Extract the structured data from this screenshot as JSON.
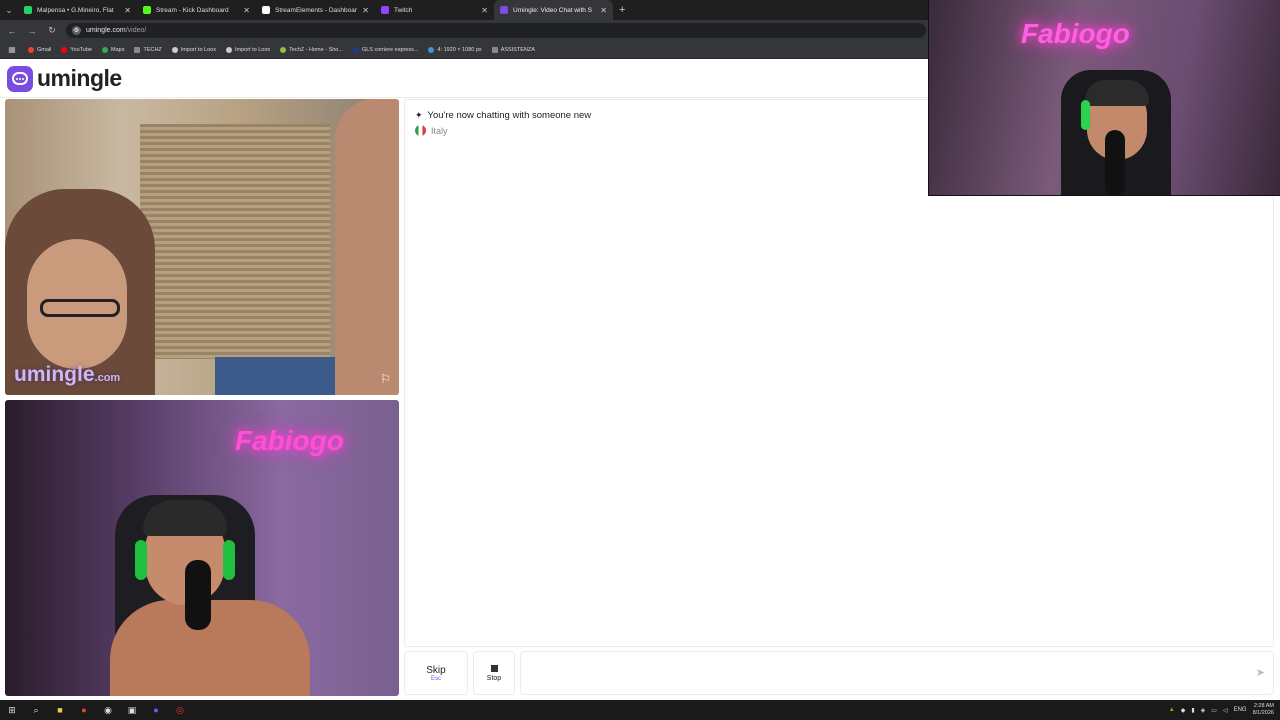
{
  "browser": {
    "tabs": [
      {
        "title": "Malpensa • G.Mineiro, Flat",
        "color": "#25d366"
      },
      {
        "title": "Stream - Kick Dashboard",
        "color": "#53fc18"
      },
      {
        "title": "StreamElements - Dashboard",
        "color": "#ffffff"
      },
      {
        "title": "Twitch",
        "color": "#9146ff"
      },
      {
        "title": "Umingle: Video Chat with S",
        "color": "#7b4ce0",
        "active": true
      }
    ],
    "url_host": "umingle.com",
    "url_path": "/video/",
    "bookmarks": [
      {
        "label": "Gmail",
        "color": "#ea4335"
      },
      {
        "label": "YouTube",
        "color": "#ff0000"
      },
      {
        "label": "Maps",
        "color": "#34a853"
      },
      {
        "label": "TECHZ",
        "color": "#888888"
      },
      {
        "label": "Import to Loox",
        "color": "#cccccc"
      },
      {
        "label": "Import to Loox",
        "color": "#cccccc"
      },
      {
        "label": "TechZ - Home - Sho...",
        "color": "#96bf48"
      },
      {
        "label": "GLS corriere espress...",
        "color": "#1a3c8c"
      },
      {
        "label": "4: 1920 × 1080 px",
        "color": "#4a90d9"
      },
      {
        "label": "ASSISTENZA",
        "color": "#888888"
      }
    ]
  },
  "site": {
    "logo_text": "umingle",
    "watermark_main": "umingle",
    "watermark_suffix": ".com"
  },
  "chat": {
    "status_message": "You're now chatting with someone new",
    "country": "Italy"
  },
  "controls": {
    "skip_label": "Skip",
    "skip_hint": "Esc",
    "stop_label": "Stop"
  },
  "overlay": {
    "neon_text": "Fabiogo"
  },
  "taskbar": {
    "language": "ENG",
    "time": "2:28 AM",
    "date": "8/1/2026"
  }
}
